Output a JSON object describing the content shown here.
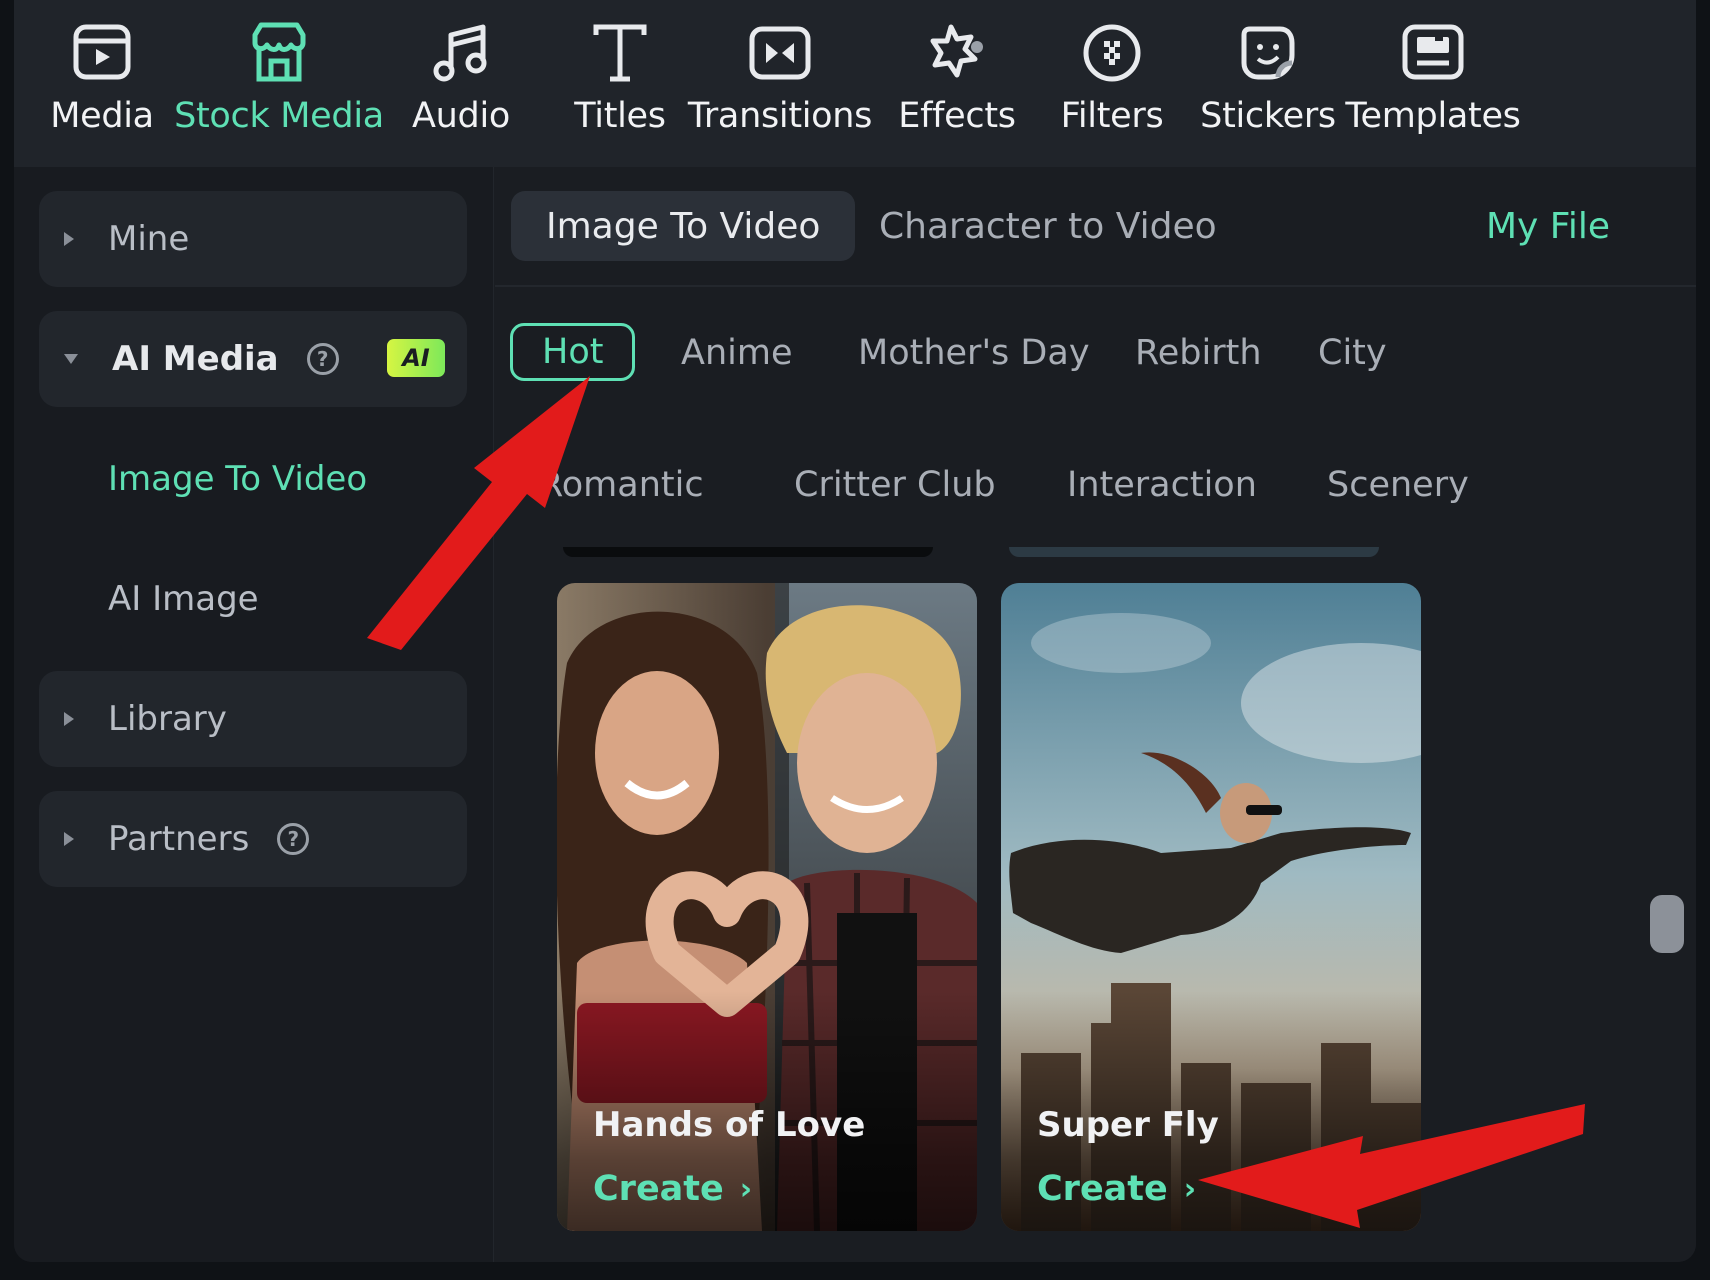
{
  "toolbar": {
    "items": [
      {
        "label": "Media",
        "icon": "media-icon"
      },
      {
        "label": "Stock Media",
        "icon": "stock-media-icon"
      },
      {
        "label": "Audio",
        "icon": "audio-icon"
      },
      {
        "label": "Titles",
        "icon": "titles-icon"
      },
      {
        "label": "Transitions",
        "icon": "transitions-icon"
      },
      {
        "label": "Effects",
        "icon": "effects-icon"
      },
      {
        "label": "Filters",
        "icon": "filters-icon"
      },
      {
        "label": "Stickers",
        "icon": "stickers-icon"
      },
      {
        "label": "Templates",
        "icon": "templates-icon"
      }
    ],
    "active": "Stock Media"
  },
  "sidebar": {
    "mine": "Mine",
    "ai_media": "AI Media",
    "ai_badge": "AI",
    "sub_items": [
      "Image To Video",
      "AI Image"
    ],
    "library": "Library",
    "partners": "Partners",
    "help_glyph": "?"
  },
  "main": {
    "tabs": [
      "Image To Video",
      "Character to Video"
    ],
    "my_file": "My File",
    "categories_row1": [
      "Hot",
      "Anime",
      "Mother's Day",
      "Rebirth",
      "City"
    ],
    "categories_row2": [
      "Romantic",
      "Critter Club",
      "Interaction",
      "Scenery"
    ],
    "cards": [
      {
        "title": "Hands of Love",
        "action": "Create",
        "chevron": "›"
      },
      {
        "title": "Super Fly",
        "action": "Create",
        "chevron": "›"
      }
    ]
  },
  "colors": {
    "accent": "#5ee0b4",
    "annotation_arrow": "#e21b1b",
    "background": "#1a1d22"
  }
}
